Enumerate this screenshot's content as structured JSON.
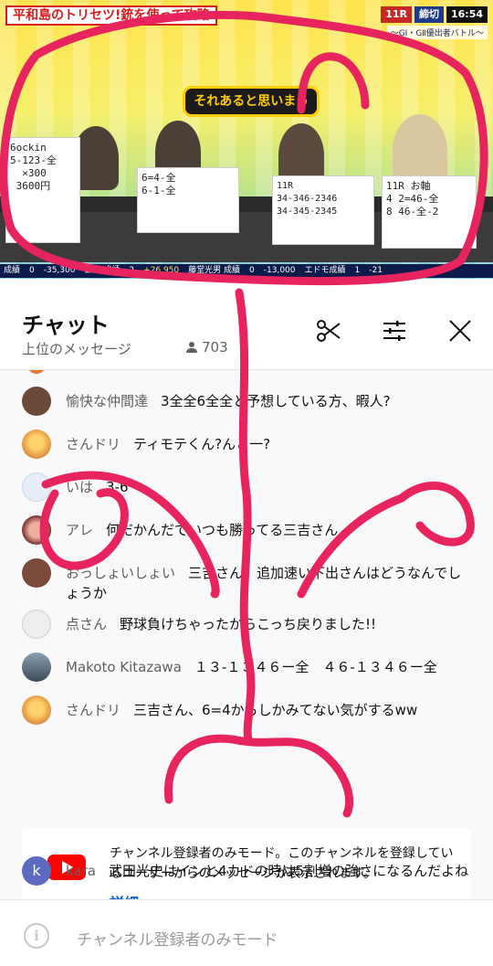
{
  "video": {
    "caption": "平和島のトリセツ!銃を使って攻略",
    "race_no": "11R",
    "race_status": "締切",
    "race_time": "16:54",
    "race_subtitle": "〜GⅠ・GⅡ優出者バトル〜",
    "show_logo": "それあると思いまっ",
    "boards": [
      "6ockin\n5-123-全\n  ×300\n 3600円",
      "6=4-全\n6-1-全",
      "11R\n34-346-2346\n34-345-2345",
      "11R お軸\n4 2=46-全\n8 46-全-2"
    ],
    "ticker": [
      {
        "label": "成績",
        "value": "0",
        "neg": false
      },
      {
        "value": "-35,300",
        "neg": true
      },
      {
        "label": "三吉 成績",
        "value": "2",
        "neg": false
      },
      {
        "value": "+26,950",
        "neg": false
      },
      {
        "label": "藤堂光男 成績",
        "value": "0",
        "neg": false
      },
      {
        "value": "-13,000",
        "neg": true
      },
      {
        "label": "エドモ成績",
        "value": "1",
        "neg": false
      },
      {
        "value": "-21",
        "neg": true
      }
    ]
  },
  "chat": {
    "title": "チャット",
    "mode_label": "上位のメッセージ",
    "viewer_count": "703",
    "messages": [
      {
        "author": "愉快な仲間達",
        "text": "3全全6全全と予想している方、暇人?",
        "avatar_color": "#6b4a3a"
      },
      {
        "author": "さんドリ",
        "text": "ティモテくん?んと一?",
        "avatar_color": "#e8a04a"
      },
      {
        "author": "いは",
        "text": "3-6",
        "avatar_color": "#4a78c4"
      },
      {
        "author": "アレ",
        "text": "何だかんだでいつも勝ってる三吉さん",
        "avatar_color": "#c85050"
      },
      {
        "author": "おっしょいしょい",
        "text": "三吉さん、追加速い下出さんはどうなんでしょうか",
        "avatar_color": "#7a4a3a"
      },
      {
        "author": "点さん",
        "text": "野球負けちゃったからこっち戻りました!!",
        "avatar_color": "#d8d8d8"
      },
      {
        "author": "Makoto Kitazawa",
        "text": "１３-１３４６ー全　４６-１３４６ー全",
        "avatar_color": "#5a6a7a"
      },
      {
        "author": "さんドリ",
        "text": "三吉さん、6=4からしかみてない気がするww",
        "avatar_color": "#e8a04a"
      }
    ],
    "notice": {
      "text": "チャンネル登録者のみモード。このチャンネルを登録しているユーザーからのメッセージが表示されます。",
      "link": "詳細"
    },
    "last_message": {
      "author": "kara",
      "text": "武田光史はインと4カドの時は5割増の強さになるんだよね",
      "avatar_letter": "k",
      "avatar_color": "#5c6bc0"
    },
    "bottom_text": "チャンネル登録者のみモード"
  },
  "colors": {
    "scribble": "#e8245f",
    "link": "#065fd4",
    "youtube_red": "#ff0000"
  }
}
